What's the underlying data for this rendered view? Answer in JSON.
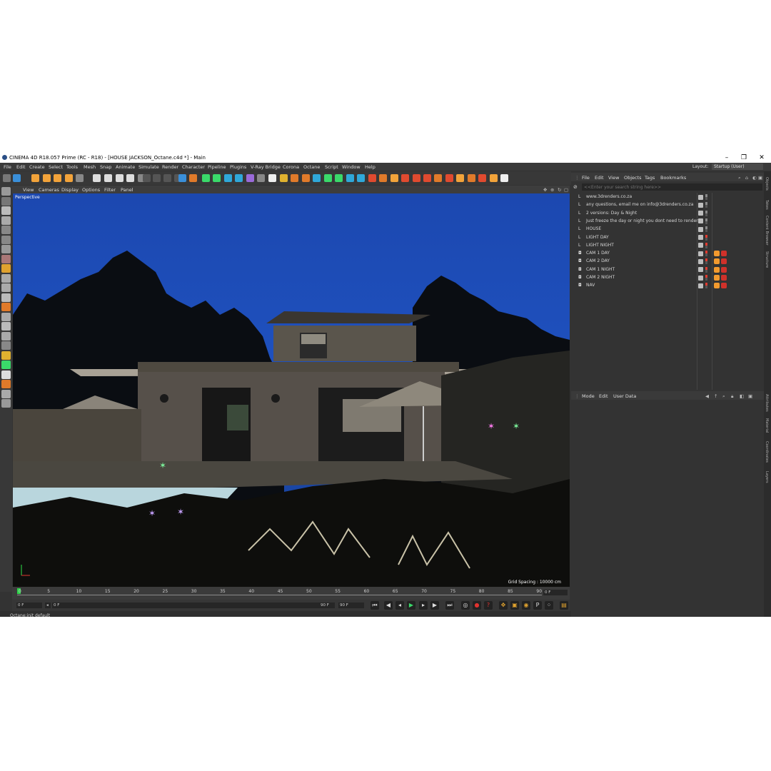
{
  "window": {
    "title": "CINEMA 4D R18.057 Prime (RC - R18) - [HOUSE JACKSON_Octane.c4d *] - Main",
    "minimize": "–",
    "maximize": "❐",
    "close": "✕"
  },
  "menubar": [
    "File",
    "Edit",
    "Create",
    "Select",
    "Tools",
    "Mesh",
    "Snap",
    "Animate",
    "Simulate",
    "Render",
    "Character",
    "Pipeline",
    "Plugins",
    "V-Ray Bridge",
    "Corona",
    "Octane",
    "Script",
    "Window",
    "Help"
  ],
  "layout": {
    "label": "Layout:",
    "value": "Startup (User)"
  },
  "viewport": {
    "menu": [
      "View",
      "Cameras",
      "Display",
      "Options",
      "Filter",
      "Panel"
    ],
    "label": "Perspective",
    "grid_spacing": "Grid Spacing : 10000 cm"
  },
  "timeline": {
    "ticks": [
      "0",
      "5",
      "10",
      "15",
      "20",
      "25",
      "30",
      "35",
      "40",
      "45",
      "50",
      "55",
      "60",
      "65",
      "70",
      "75",
      "80",
      "85",
      "90"
    ],
    "current_frame": "0 F",
    "start_frame": "0 F",
    "preview_start": "0 F",
    "preview_end": "90 F",
    "end_frame": "90 F"
  },
  "status": {
    "text": "Octane:init default"
  },
  "object_manager": {
    "menu": [
      "File",
      "Edit",
      "View",
      "Objects",
      "Tags",
      "Bookmarks"
    ],
    "search_placeholder": "<<Enter your search string here>>",
    "objects": [
      {
        "name": "www.3drenders.co.za",
        "icon": "text-layer-icon"
      },
      {
        "name": "any questions, email me on info@3drenders.co.za",
        "icon": "text-layer-icon"
      },
      {
        "name": "2 versions: Day & Night",
        "icon": "text-layer-icon"
      },
      {
        "name": "Just freeze the day or night you dont need to render",
        "icon": "text-layer-icon"
      },
      {
        "name": "HOUSE",
        "icon": "null-object-icon"
      },
      {
        "name": "LIGHT DAY",
        "icon": "null-object-icon"
      },
      {
        "name": "LIGHT NIGHT",
        "icon": "null-object-icon"
      },
      {
        "name": "CAM 1 DAY",
        "icon": "camera-icon"
      },
      {
        "name": "CAM 2 DAY",
        "icon": "camera-icon"
      },
      {
        "name": "CAM 1 NIGHT",
        "icon": "camera-icon"
      },
      {
        "name": "CAM 2 NIGHT",
        "icon": "camera-icon"
      },
      {
        "name": "NAV",
        "icon": "camera-icon"
      }
    ]
  },
  "attribute_manager": {
    "menu": [
      "Mode",
      "Edit",
      "User Data"
    ]
  },
  "side_tabs": [
    "Objects",
    "Takes",
    "Content Browser",
    "Structure",
    "Attributes",
    "Material",
    "Coordinates",
    "Layers"
  ],
  "colors": {
    "sky": "#1f4fb8",
    "panel": "#333333",
    "accent": "#f29a2e"
  }
}
